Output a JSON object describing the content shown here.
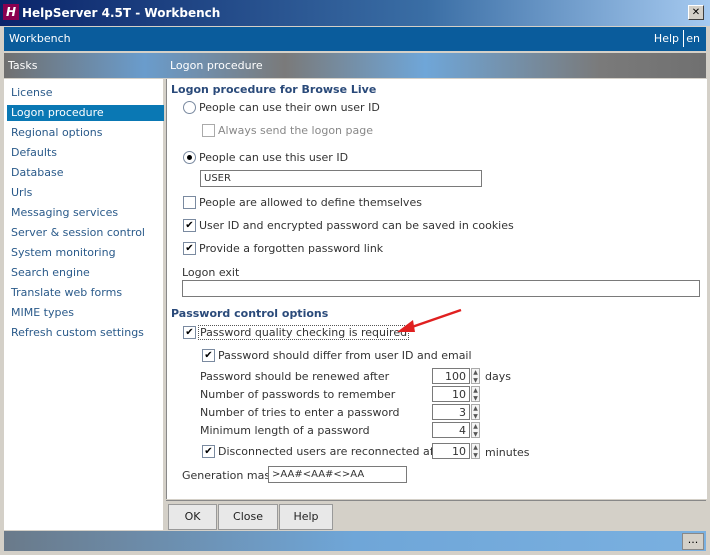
{
  "window": {
    "title": "HelpServer 4.5T - Workbench",
    "icon": "app-h-icon"
  },
  "topbar": {
    "title": "Workbench",
    "help": "Help",
    "lang": "en"
  },
  "header": {
    "tasks": "Tasks",
    "section": "Logon procedure"
  },
  "sidebar": {
    "items": [
      {
        "label": "License"
      },
      {
        "label": "Logon procedure",
        "selected": true
      },
      {
        "label": "Regional options"
      },
      {
        "label": "Defaults"
      },
      {
        "label": "Database"
      },
      {
        "label": "Urls"
      },
      {
        "label": "Messaging services"
      },
      {
        "label": "Server & session control"
      },
      {
        "label": "System monitoring"
      },
      {
        "label": "Search engine"
      },
      {
        "label": "Translate web forms"
      },
      {
        "label": "MIME types"
      },
      {
        "label": "Refresh custom settings"
      }
    ]
  },
  "logon": {
    "heading": "Logon procedure for Browse Live",
    "own_id": "People can use their own user ID",
    "always_send": "Always send the logon page",
    "this_id": "People can use this user ID",
    "user_id_value": "USER",
    "allowed_define": "People are allowed to define themselves",
    "cookies": "User ID and encrypted password can be saved in cookies",
    "forgotten": "Provide a forgotten password link",
    "logon_exit": "Logon exit",
    "logon_exit_value": ""
  },
  "password": {
    "heading": "Password control options",
    "quality": "Password quality checking is required",
    "differ": "Password should differ from user ID and email",
    "renew": "Password should be renewed after",
    "renew_value": "100",
    "renew_unit": "days",
    "remember": "Number of passwords to remember",
    "remember_value": "10",
    "tries": "Number of tries to enter a password",
    "tries_value": "3",
    "minlen": "Minimum length of a password",
    "minlen_value": "4",
    "reconnect": "Disconnected users are reconnected after",
    "reconnect_value": "10",
    "reconnect_unit": "minutes",
    "mask": "Generation mask",
    "mask_value": ">AA#<AA#<>AA"
  },
  "buttons": {
    "ok": "OK",
    "close": "Close",
    "help": "Help",
    "more": "..."
  },
  "colors": {
    "accent": "#0a5c9c",
    "selected": "#0a78b4",
    "arrow": "#e02020"
  }
}
